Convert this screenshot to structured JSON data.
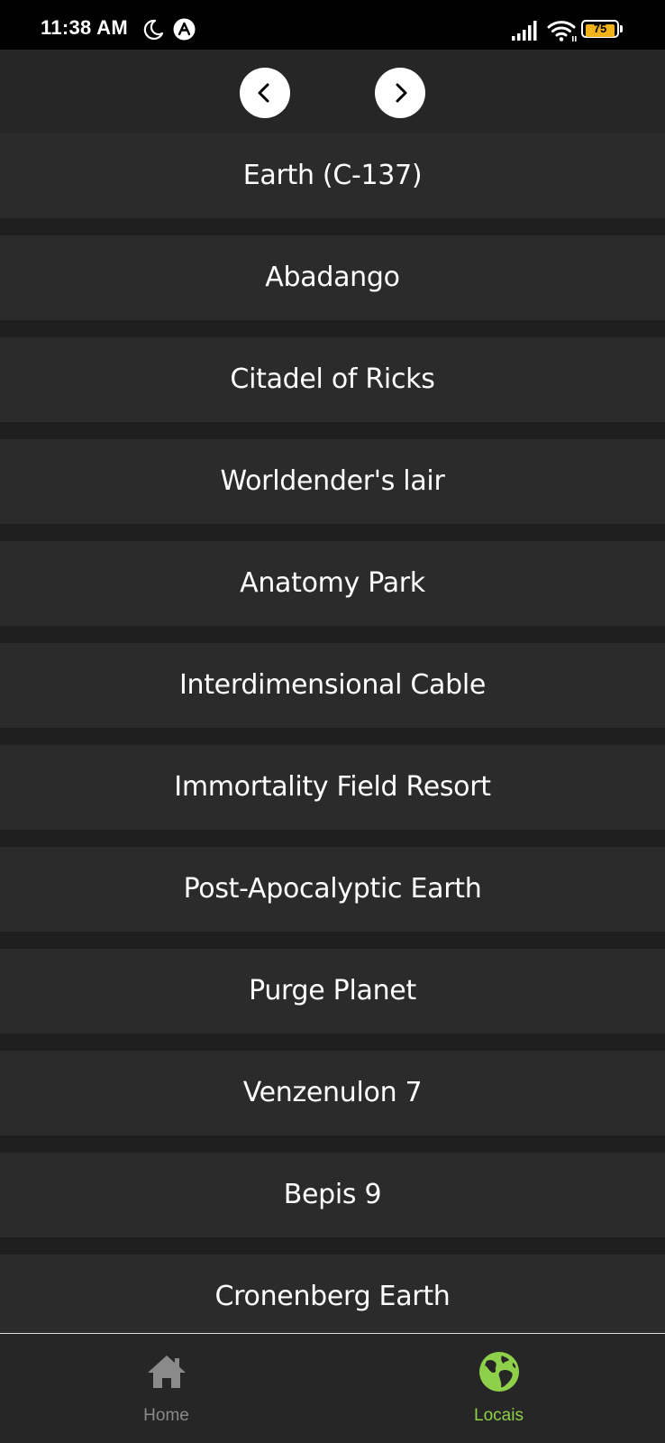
{
  "status_bar": {
    "time": "11:38 AM",
    "battery_level": "75",
    "icons": [
      "moon-icon",
      "app-notification-icon",
      "signal-icon",
      "wifi-icon",
      "battery-icon"
    ]
  },
  "pager": {
    "prev_icon": "chevron-left-icon",
    "next_icon": "chevron-right-icon"
  },
  "locations": [
    "Earth (C-137)",
    "Abadango",
    "Citadel of Ricks",
    "Worldender's lair",
    "Anatomy Park",
    "Interdimensional Cable",
    "Immortality Field Resort",
    "Post-Apocalyptic Earth",
    "Purge Planet",
    "Venzenulon 7",
    "Bepis 9",
    "Cronenberg Earth"
  ],
  "bottom_nav": {
    "tabs": [
      {
        "label": "Home",
        "icon": "home-icon",
        "active": false
      },
      {
        "label": "Locais",
        "icon": "globe-icon",
        "active": true
      }
    ]
  },
  "colors": {
    "background": "#1f1f1f",
    "item_background": "#2b2b2b",
    "text": "#ffffff",
    "nav_inactive": "#8a8a8a",
    "nav_active": "#8ed04a",
    "battery": "#f2b31a"
  }
}
